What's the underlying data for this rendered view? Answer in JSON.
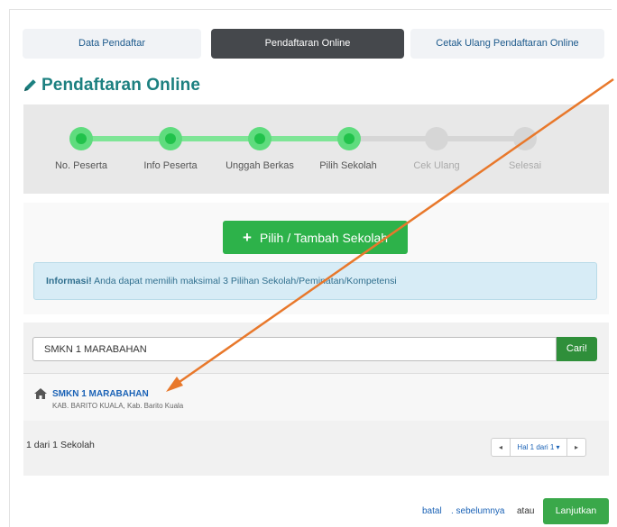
{
  "tabs": [
    {
      "label": "Data Pendaftar"
    },
    {
      "label": "Pendaftaran Online"
    },
    {
      "label": "Cetak Ulang Pendaftaran Online"
    }
  ],
  "page_title": "Pendaftaran Online",
  "title_icon": "pencil-icon",
  "steps": [
    {
      "label": "No. Peserta",
      "done": true
    },
    {
      "label": "Info Peserta",
      "done": true
    },
    {
      "label": "Unggah Berkas",
      "done": true
    },
    {
      "label": "Pilih Sekolah",
      "done": true
    },
    {
      "label": "Cek Ulang",
      "done": false
    },
    {
      "label": "Selesai",
      "done": false
    }
  ],
  "add_school_label": "Pilih / Tambah Sekolah",
  "info": {
    "prefix": "Informasi!",
    "text": " Anda dapat memilih maksimal 3 Pilihan Sekolah/Peminatan/Kompetensi"
  },
  "search": {
    "value": "SMKN 1 MARABAHAN",
    "button_label": "Cari!"
  },
  "school": {
    "name": "SMKN 1 MARABAHAN",
    "address": "KAB. BARITO KUALA, Kab. Barito Kuala",
    "icon": "home-icon"
  },
  "result_count": "1 dari 1 Sekolah",
  "pager": {
    "prev": "◂",
    "label": "Hal 1 dari 1 ▾",
    "next": "▸"
  },
  "footer": {
    "cancel": "batal",
    "previous": ". sebelumnya",
    "or": "atau",
    "continue": "Lanjutkan"
  },
  "colors": {
    "accent_teal": "#1c8080",
    "step_done": "#21c24b",
    "add_button": "#2db24a",
    "annotation_arrow": "#e8782b"
  }
}
